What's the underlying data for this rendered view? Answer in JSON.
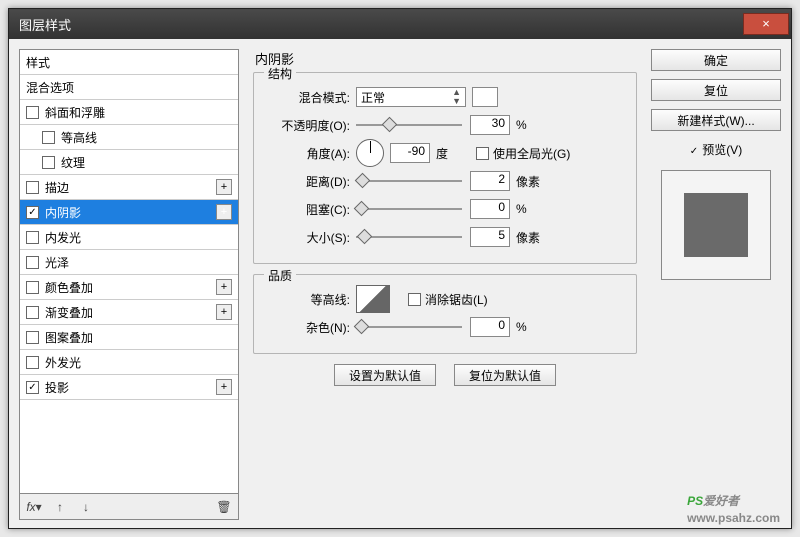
{
  "window": {
    "title": "图层样式"
  },
  "sidebar": {
    "header1": "样式",
    "header2": "混合选项",
    "items": [
      {
        "label": "斜面和浮雕",
        "checked": false,
        "plus": false,
        "indent": false
      },
      {
        "label": "等高线",
        "checked": false,
        "plus": false,
        "indent": true
      },
      {
        "label": "纹理",
        "checked": false,
        "plus": false,
        "indent": true
      },
      {
        "label": "描边",
        "checked": false,
        "plus": true,
        "indent": false
      },
      {
        "label": "内阴影",
        "checked": true,
        "plus": true,
        "indent": false,
        "selected": true
      },
      {
        "label": "内发光",
        "checked": false,
        "plus": false,
        "indent": false
      },
      {
        "label": "光泽",
        "checked": false,
        "plus": false,
        "indent": false
      },
      {
        "label": "颜色叠加",
        "checked": false,
        "plus": true,
        "indent": false
      },
      {
        "label": "渐变叠加",
        "checked": false,
        "plus": true,
        "indent": false
      },
      {
        "label": "图案叠加",
        "checked": false,
        "plus": false,
        "indent": false
      },
      {
        "label": "外发光",
        "checked": false,
        "plus": false,
        "indent": false
      },
      {
        "label": "投影",
        "checked": true,
        "plus": true,
        "indent": false
      }
    ]
  },
  "panel": {
    "title": "内阴影",
    "structure": {
      "title": "结构",
      "blendMode": {
        "label": "混合模式:",
        "value": "正常"
      },
      "opacity": {
        "label": "不透明度(O):",
        "value": "30",
        "unit": "%"
      },
      "angle": {
        "label": "角度(A):",
        "value": "-90",
        "unit": "度",
        "globalLabel": "使用全局光(G)",
        "globalChecked": false
      },
      "distance": {
        "label": "距离(D):",
        "value": "2",
        "unit": "像素"
      },
      "choke": {
        "label": "阻塞(C):",
        "value": "0",
        "unit": "%"
      },
      "size": {
        "label": "大小(S):",
        "value": "5",
        "unit": "像素"
      }
    },
    "quality": {
      "title": "品质",
      "contour": {
        "label": "等高线:",
        "antiAliasLabel": "消除锯齿(L)",
        "antiAliasChecked": false
      },
      "noise": {
        "label": "杂色(N):",
        "value": "0",
        "unit": "%"
      }
    },
    "buttons": {
      "setDefault": "设置为默认值",
      "resetDefault": "复位为默认值"
    }
  },
  "actions": {
    "ok": "确定",
    "cancel": "复位",
    "newStyle": "新建样式(W)...",
    "previewLabel": "预览(V)",
    "previewChecked": true
  },
  "watermark": {
    "brand1": "PS",
    "brand2": "爱好者",
    "url": "www.psahz.com"
  }
}
